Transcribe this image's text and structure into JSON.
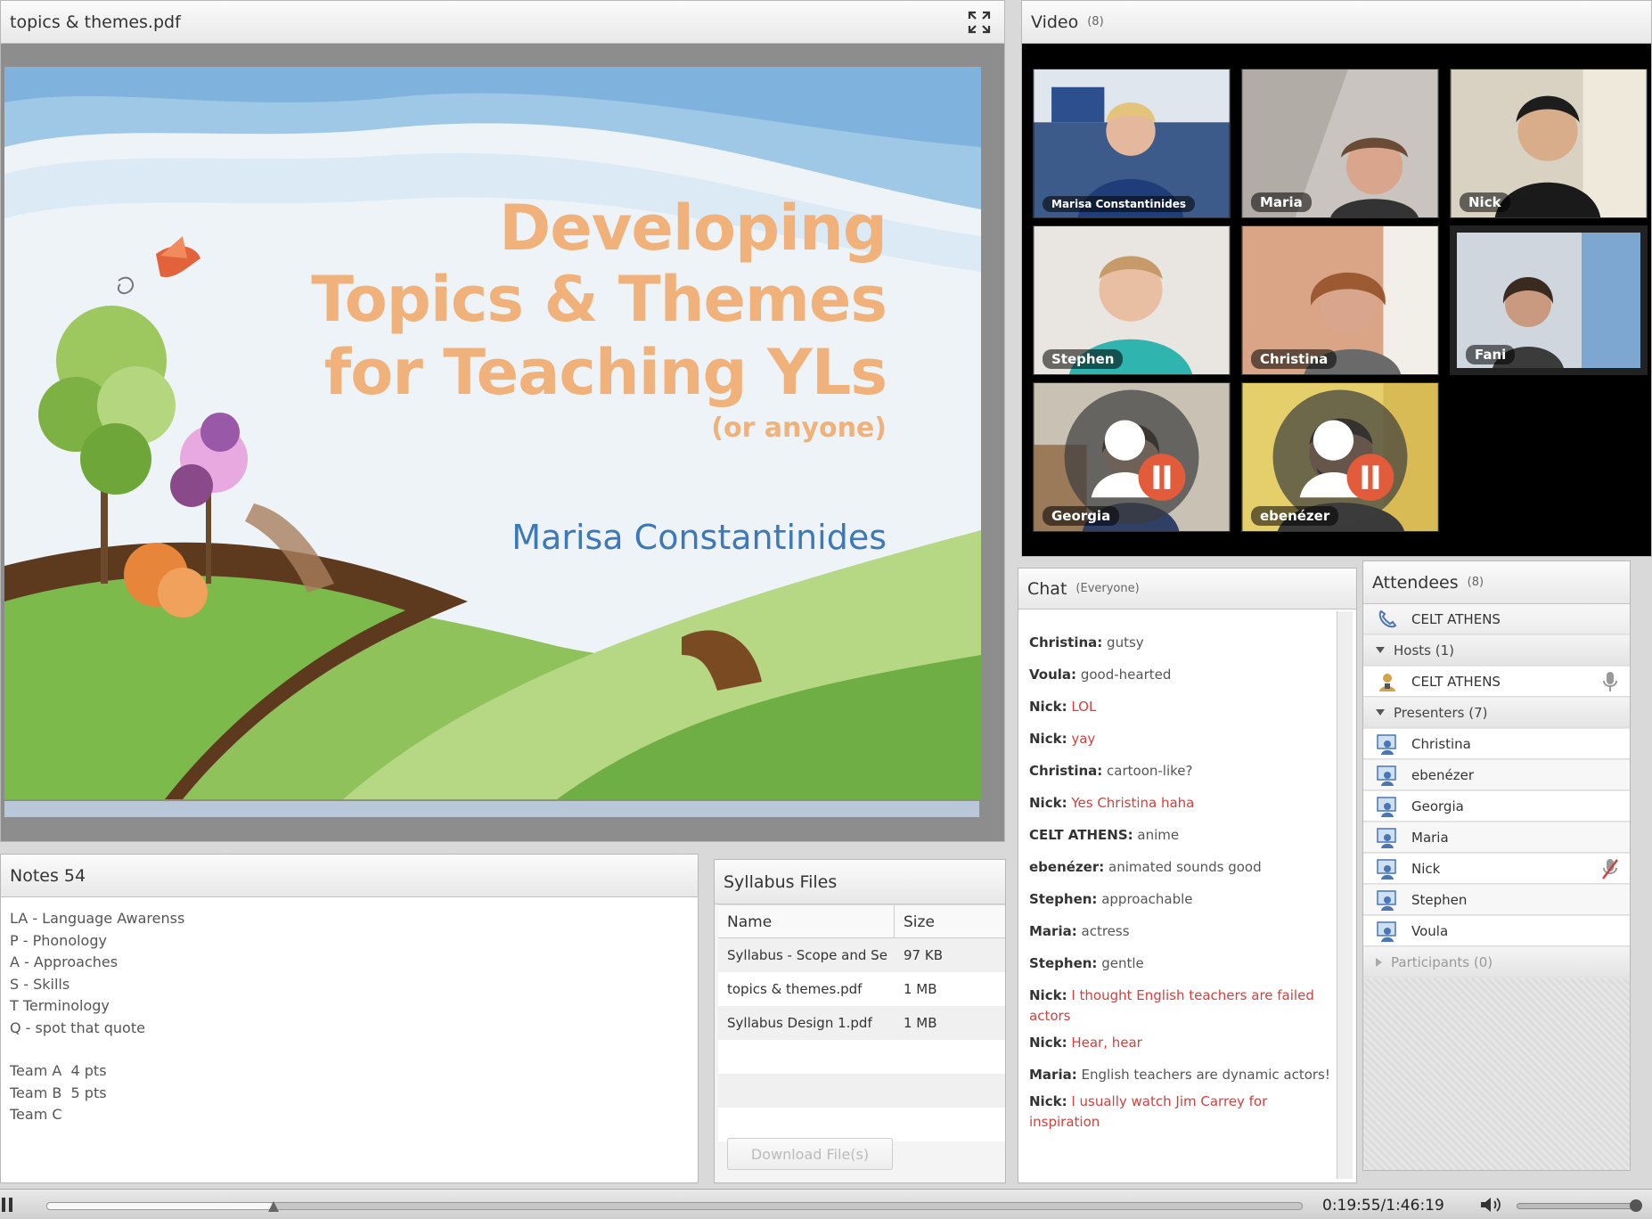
{
  "share": {
    "title": "topics & themes.pdf",
    "slide": {
      "title_line_1": "Developing",
      "title_line_2": "Topics & Themes",
      "title_line_3": "for Teaching YLs",
      "subtitle": "(or anyone)",
      "author": "Marisa Constantinides"
    }
  },
  "video": {
    "title": "Video",
    "count": "(8)",
    "participants": [
      {
        "name": "Marisa Constantinides",
        "muted": false
      },
      {
        "name": "Maria",
        "muted": false
      },
      {
        "name": "Nick",
        "muted": false
      },
      {
        "name": "Stephen",
        "muted": false
      },
      {
        "name": "Christina",
        "muted": false
      },
      {
        "name": "Fani",
        "muted": false
      },
      {
        "name": "Georgia",
        "muted": true
      },
      {
        "name": "ebenézer",
        "muted": true
      }
    ]
  },
  "notes": {
    "title": "Notes 54",
    "lines": [
      "LA - Language Awarenss",
      "P - Phonology",
      "A - Approaches",
      "S - Skills",
      "T Terminology",
      "Q - spot that quote"
    ],
    "teams": [
      "Team A  4 pts",
      "Team B  5 pts",
      "Team C"
    ]
  },
  "files": {
    "title": "Syllabus Files",
    "col_name": "Name",
    "col_size": "Size",
    "rows": [
      {
        "name": "Syllabus - Scope and Se",
        "size": "97 KB"
      },
      {
        "name": "topics & themes.pdf",
        "size": "1 MB"
      },
      {
        "name": "Syllabus Design 1.pdf",
        "size": "1 MB"
      }
    ],
    "download_label": "Download File(s)"
  },
  "chat": {
    "title": "Chat",
    "scope": "(Everyone)",
    "messages": [
      {
        "sender": "Christina:",
        "text": "gutsy",
        "highlight": false
      },
      {
        "sender": "Voula:",
        "text": "good-hearted",
        "highlight": false
      },
      {
        "sender": "Nick:",
        "text": "LOL",
        "highlight": true
      },
      {
        "sender": "Nick:",
        "text": "yay",
        "highlight": true
      },
      {
        "sender": "Christina:",
        "text": "cartoon-like?",
        "highlight": false
      },
      {
        "sender": "Nick:",
        "text": "Yes Christina haha",
        "highlight": true
      },
      {
        "sender": "CELT ATHENS:",
        "text": "anime",
        "highlight": false
      },
      {
        "sender": "ebenézer:",
        "text": "animated sounds good",
        "highlight": false
      },
      {
        "sender": "Stephen:",
        "text": "approachable",
        "highlight": false
      },
      {
        "sender": "Maria:",
        "text": "actress",
        "highlight": false
      },
      {
        "sender": "Stephen:",
        "text": "gentle",
        "highlight": false
      },
      {
        "sender": "Nick:",
        "text": "I thought English teachers are failed actors",
        "highlight": true
      },
      {
        "sender": "Nick:",
        "text": "Hear, hear",
        "highlight": true
      },
      {
        "sender": "Maria:",
        "text": "English teachers are dynamic actors!",
        "highlight": false
      },
      {
        "sender": "Nick:",
        "text": "I usually watch Jim Carrey for inspiration",
        "highlight": true
      }
    ]
  },
  "attendees": {
    "title": "Attendees",
    "count": "(8)",
    "organizer": "CELT ATHENS",
    "hosts_label": "Hosts (1)",
    "hosts": [
      "CELT ATHENS"
    ],
    "presenters_label": "Presenters (7)",
    "presenters": [
      "Christina",
      "ebenézer",
      "Georgia",
      "Maria",
      "Nick",
      "Stephen",
      "Voula"
    ],
    "participants_label": "Participants (0)"
  },
  "playback": {
    "time": "0:19:55/1:46:19",
    "progress": 0.18,
    "volume": 1.0
  },
  "colors": {
    "chat_highlight": "#d0413f",
    "slide_title": "#f0b27a",
    "slide_author": "#3d78b8"
  }
}
